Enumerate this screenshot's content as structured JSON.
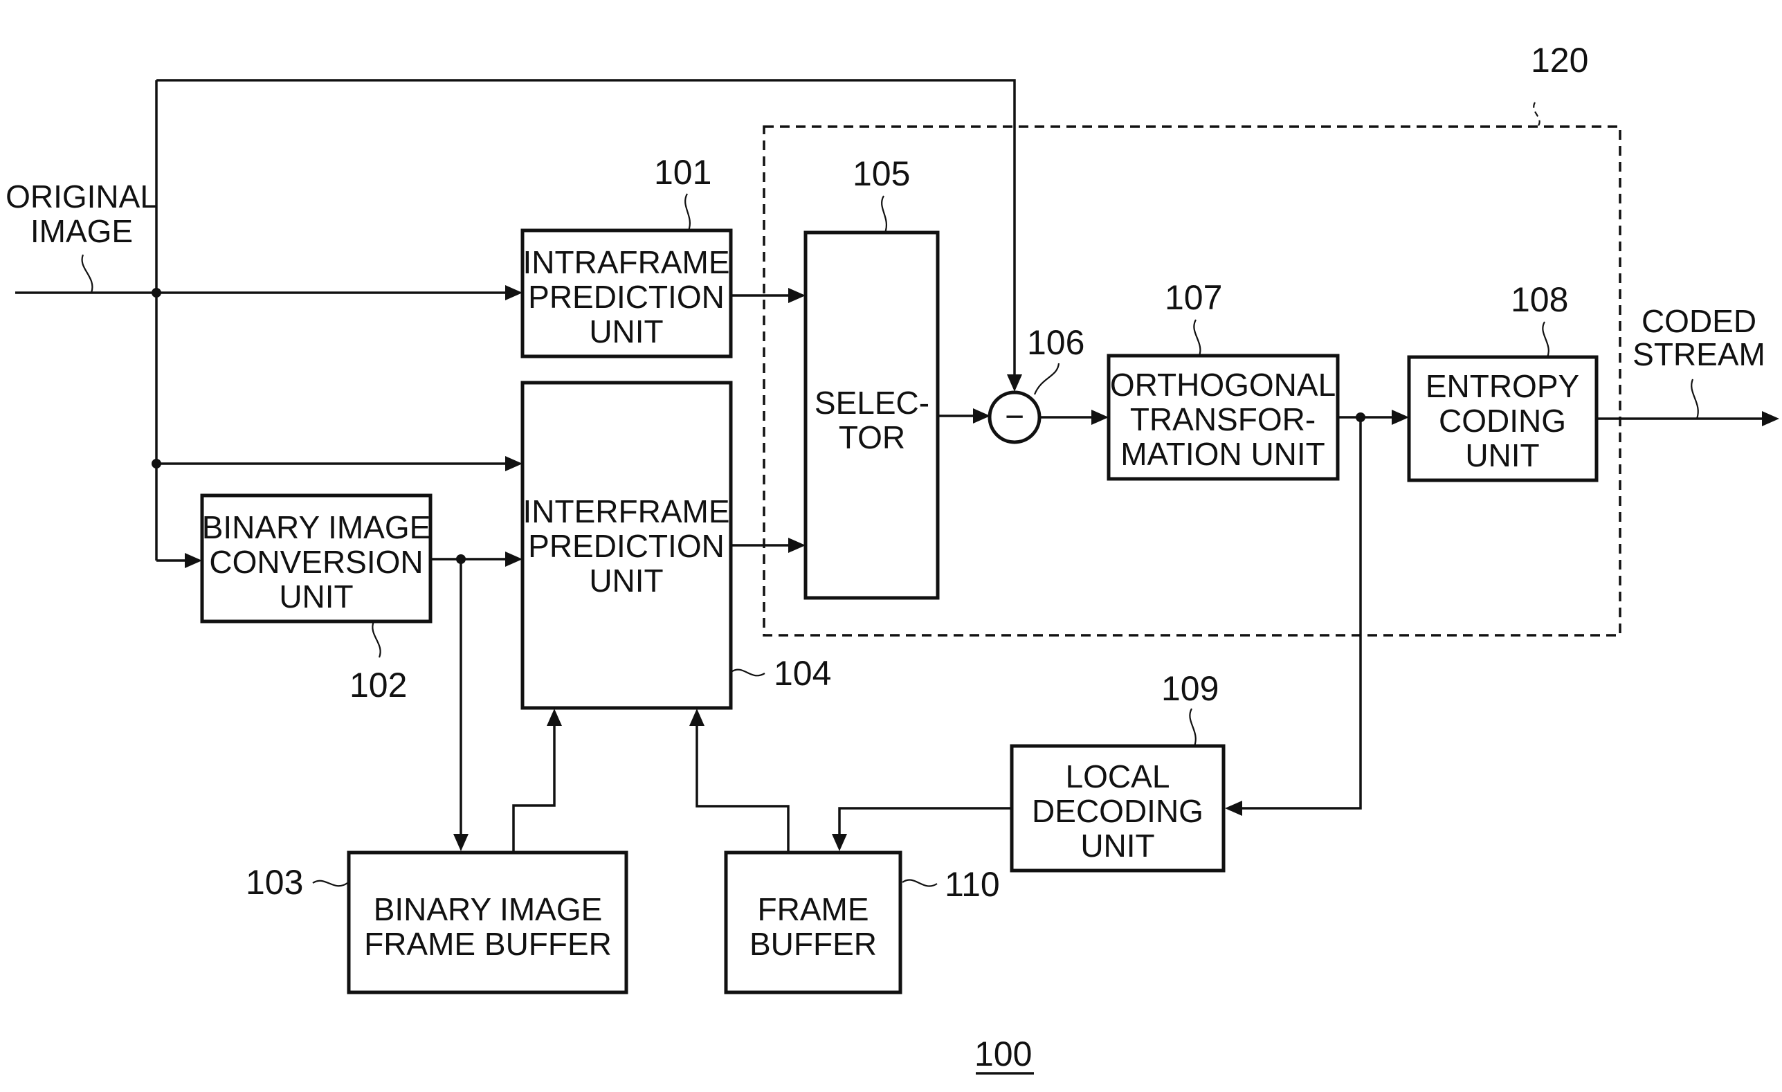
{
  "figure": {
    "reference": "100",
    "input_label": [
      "ORIGINAL",
      "IMAGE"
    ],
    "output_label": [
      "CODED",
      "STREAM"
    ],
    "group": {
      "ref": "120"
    },
    "blocks": {
      "intraframe": {
        "ref": "101",
        "lines": [
          "INTRAFRAME",
          "PREDICTION",
          "UNIT"
        ]
      },
      "binary_conversion": {
        "ref": "102",
        "lines": [
          "BINARY IMAGE",
          "CONVERSION",
          "UNIT"
        ]
      },
      "binary_frame_buffer": {
        "ref": "103",
        "lines": [
          "BINARY IMAGE",
          "FRAME BUFFER"
        ]
      },
      "interframe": {
        "ref": "104",
        "lines": [
          "INTERFRAME",
          "PREDICTION",
          "UNIT"
        ]
      },
      "selector": {
        "ref": "105",
        "lines": [
          "SELEC-",
          "TOR"
        ]
      },
      "subtractor": {
        "ref": "106",
        "symbol": "−"
      },
      "orthogonal": {
        "ref": "107",
        "lines": [
          "ORTHOGONAL",
          "TRANSFOR-",
          "MATION UNIT"
        ]
      },
      "entropy": {
        "ref": "108",
        "lines": [
          "ENTROPY",
          "CODING",
          "UNIT"
        ]
      },
      "local_decoding": {
        "ref": "109",
        "lines": [
          "LOCAL",
          "DECODING",
          "UNIT"
        ]
      },
      "frame_buffer": {
        "ref": "110",
        "lines": [
          "FRAME",
          "BUFFER"
        ]
      }
    }
  }
}
